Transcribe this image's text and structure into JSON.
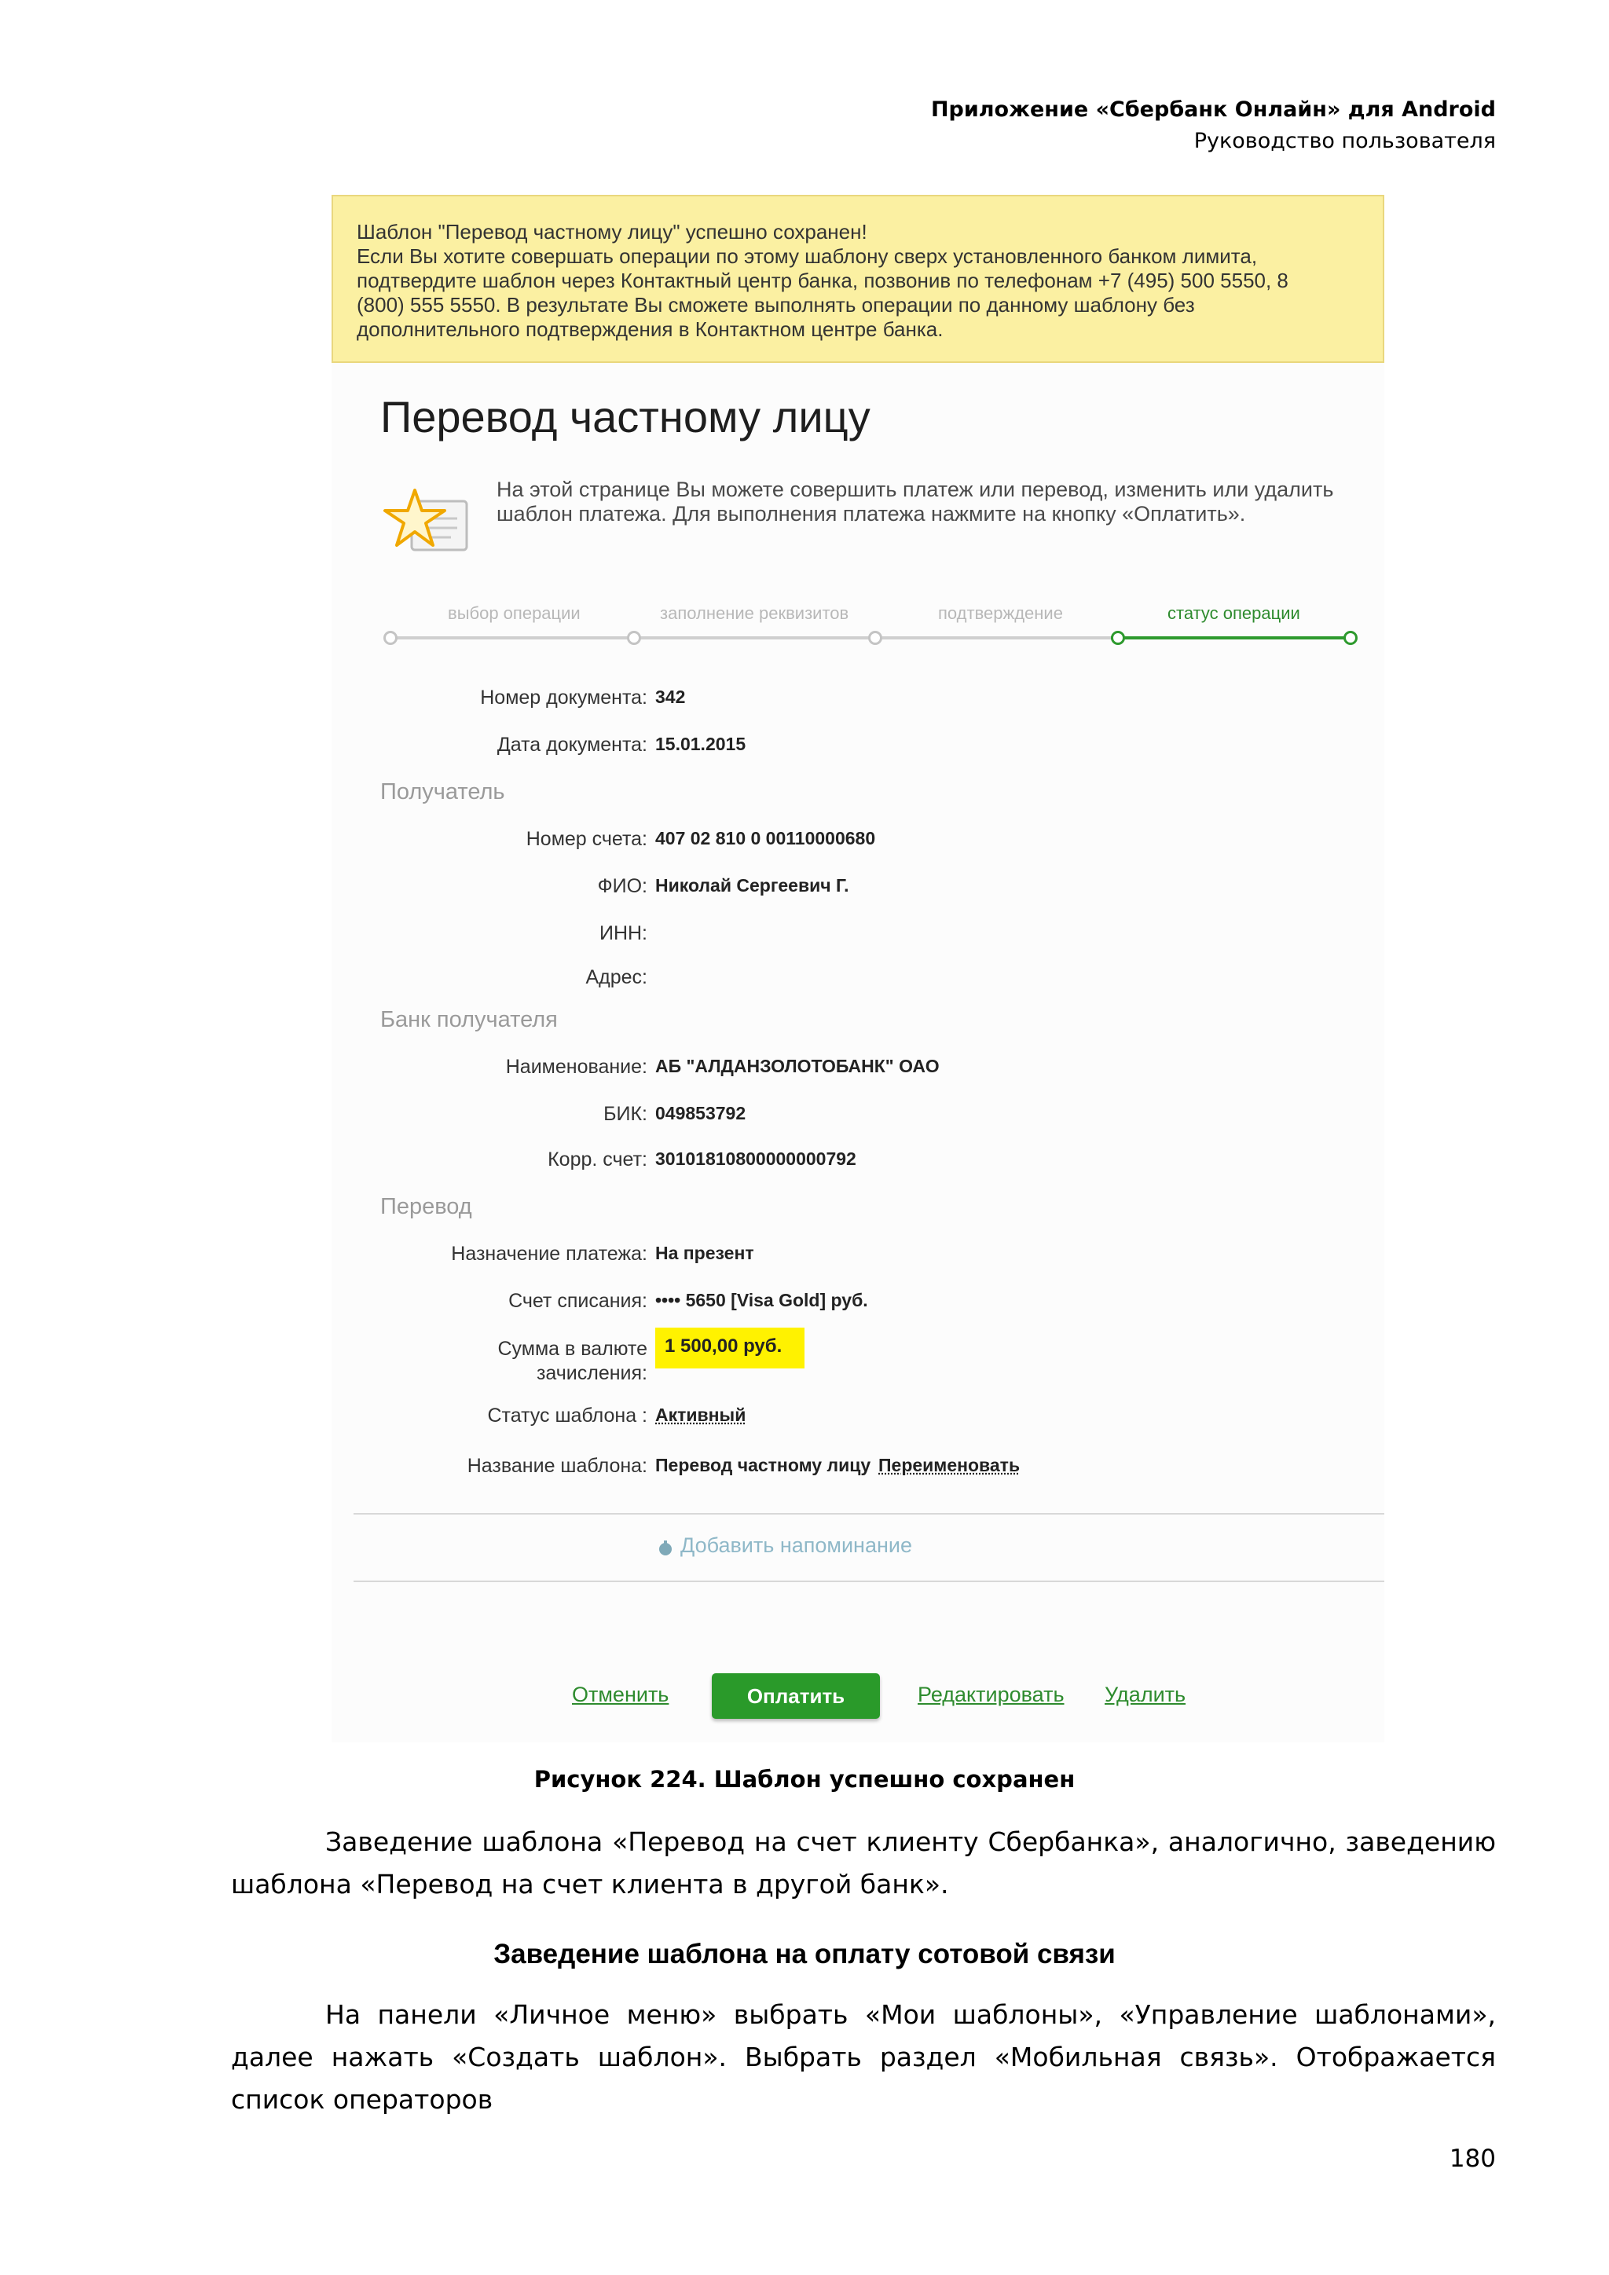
{
  "doc_header": {
    "title": "Приложение «Сбербанк Онлайн» для Android",
    "subtitle": "Руководство пользователя"
  },
  "notice": {
    "lines": [
      "Шаблон \"Перевод частному лицу\" успешно сохранен!",
      "Если Вы хотите совершать операции по этому шаблону сверх установленного банком лимита,",
      "подтвердите шаблон через Контактный центр банка, позвонив по телефонам +7 (495) 500 5550, 8",
      "(800) 555 5550. В результате Вы сможете выполнять операции по данному шаблону без",
      "дополнительного подтверждения в Контактном центре банка."
    ]
  },
  "page_title": "Перевод частному лицу",
  "intro": {
    "line1": "На этой странице Вы можете совершить платеж или перевод, изменить или удалить",
    "line2": "шаблон платежа. Для выполнения платежа нажмите на кнопку «Оплатить»."
  },
  "stepper": {
    "steps": [
      "выбор операции",
      "заполнение реквизитов",
      "подтверждение",
      "статус операции"
    ],
    "active_index": 3
  },
  "fields": {
    "doc_number_label": "Номер документа:",
    "doc_number": "342",
    "doc_date_label": "Дата документа:",
    "doc_date": "15.01.2015",
    "recipient_section": "Получатель",
    "account_label": "Номер счета:",
    "account": "407 02 810 0 00110000680",
    "name_label": "ФИО:",
    "name": "Николай Сергеевич Г.",
    "inn_label": "ИНН:",
    "address_label": "Адрес:",
    "bank_section": "Банк получателя",
    "bank_name_label": "Наименование:",
    "bank_name": "АБ \"АЛДАНЗОЛОТОБАНК\" ОАО",
    "bik_label": "БИК:",
    "bik": "049853792",
    "corr_label": "Корр. счет:",
    "corr": "30101810800000000792",
    "transfer_section": "Перевод",
    "purpose_label": "Назначение платежа:",
    "purpose": "На презент",
    "debit_label": "Счет списания:",
    "debit": "•••• 5650  [Visa Gold]  руб.",
    "amount_label_1": "Сумма в валюте",
    "amount_label_2": "зачисления:",
    "amount": "1 500,00   руб.",
    "status_label": "Статус шаблона :",
    "status": "Активный",
    "template_name_label": "Название шаблона:",
    "template_name": "Перевод частному лицу",
    "rename": "Переименовать"
  },
  "reminder": "Добавить напоминание",
  "actions": {
    "cancel": "Отменить",
    "pay": "Оплатить",
    "edit": "Редактировать",
    "delete": "Удалить"
  },
  "caption": "Рисунок 224. Шаблон успешно сохранен",
  "paragraph1": "Заведение шаблона «Перевод на счет клиенту Сбербанка», аналогично, заведению шаблона «Перевод на счет клиента в другой банк».",
  "subheading": "Заведение шаблона на оплату сотовой связи",
  "paragraph2": "На панели «Личное меню» выбрать «Мои шаблоны», «Управление шаблонами», далее нажать «Создать шаблон». Выбрать раздел «Мобильная связь». Отображается список операторов",
  "page_number": "180",
  "colors": {
    "accent_green": "#2a9a2a",
    "notice_bg": "#fbf0a2",
    "highlight": "#fff200"
  },
  "icons": [
    "star-document-icon",
    "reminder-icon"
  ]
}
